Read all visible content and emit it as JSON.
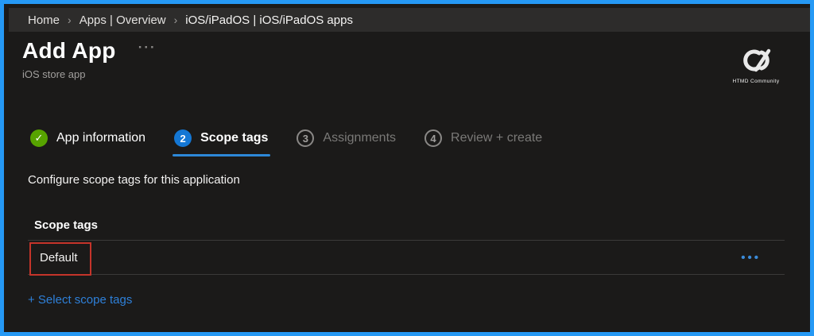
{
  "breadcrumb": {
    "items": [
      "Home",
      "Apps | Overview",
      "iOS/iPadOS | iOS/iPadOS apps"
    ],
    "separator": "›"
  },
  "header": {
    "title": "Add App",
    "menu_glyph": "···",
    "subtitle": "iOS store app"
  },
  "logo": {
    "label": "HTMD Community"
  },
  "wizard": {
    "steps": [
      {
        "label": "App information",
        "status": "complete",
        "glyph": "✓"
      },
      {
        "label": "Scope tags",
        "status": "active",
        "number": "2"
      },
      {
        "label": "Assignments",
        "status": "upcoming",
        "number": "3"
      },
      {
        "label": "Review + create",
        "status": "upcoming",
        "number": "4"
      }
    ]
  },
  "content": {
    "description": "Configure scope tags for this application",
    "table": {
      "header": "Scope tags",
      "rows": [
        {
          "value": "Default"
        }
      ],
      "row_menu_glyph": "•••"
    },
    "add_link_label": "+ Select scope tags"
  },
  "colors": {
    "frame_border": "#2599f5",
    "background": "#1b1a19",
    "breadcrumb_bar": "#2d2c2b",
    "success_green": "#57a300",
    "accent_blue": "#1477d4",
    "underline_blue": "#2d88d8",
    "link_blue": "#2e80d9",
    "annotation_red": "#c5342a"
  }
}
